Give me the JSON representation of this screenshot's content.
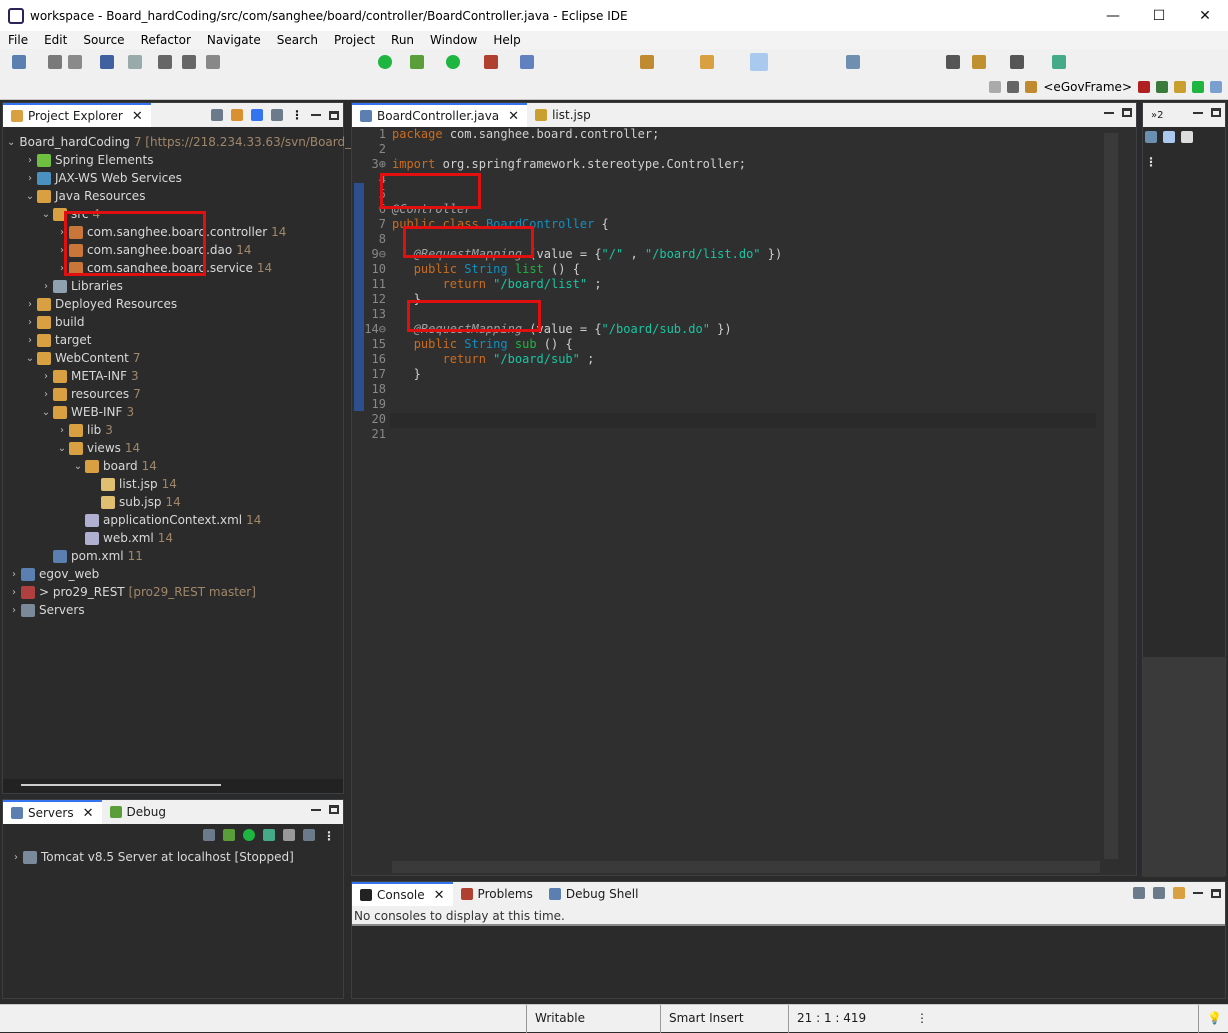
{
  "window": {
    "title": "workspace - Board_hardCoding/src/com/sanghee/board/controller/BoardController.java - Eclipse IDE",
    "min": "—",
    "max": "☐",
    "close": "✕"
  },
  "menu": [
    "File",
    "Edit",
    "Source",
    "Refactor",
    "Navigate",
    "Search",
    "Project",
    "Run",
    "Window",
    "Help"
  ],
  "perspective": {
    "label": "<eGovFrame>"
  },
  "explorer": {
    "tab": "Project Explorer",
    "items": [
      {
        "label": "Board_hardCoding",
        "dec": "7 [https://218.234.33.63/svn/Board_",
        "indent": 0,
        "arrow": "v"
      },
      {
        "label": "Spring Elements",
        "dec": "",
        "indent": 1,
        "arrow": ">"
      },
      {
        "label": "JAX-WS Web Services",
        "dec": "",
        "indent": 1,
        "arrow": ">"
      },
      {
        "label": "Java Resources",
        "dec": "",
        "indent": 1,
        "arrow": "v"
      },
      {
        "label": "src",
        "dec": "4",
        "indent": 2,
        "arrow": "v"
      },
      {
        "label": "com.sanghee.board.controller",
        "dec": "14",
        "indent": 3,
        "arrow": ">"
      },
      {
        "label": "com.sanghee.board.dao",
        "dec": "14",
        "indent": 3,
        "arrow": ">"
      },
      {
        "label": "com.sanghee.board.service",
        "dec": "14",
        "indent": 3,
        "arrow": ">"
      },
      {
        "label": "Libraries",
        "dec": "",
        "indent": 2,
        "arrow": ">"
      },
      {
        "label": "Deployed Resources",
        "dec": "",
        "indent": 1,
        "arrow": ">"
      },
      {
        "label": "build",
        "dec": "",
        "indent": 1,
        "arrow": ">"
      },
      {
        "label": "target",
        "dec": "",
        "indent": 1,
        "arrow": ">"
      },
      {
        "label": "WebContent",
        "dec": "7",
        "indent": 1,
        "arrow": "v"
      },
      {
        "label": "META-INF",
        "dec": "3",
        "indent": 2,
        "arrow": ">"
      },
      {
        "label": "resources",
        "dec": "7",
        "indent": 2,
        "arrow": ">"
      },
      {
        "label": "WEB-INF",
        "dec": "3",
        "indent": 2,
        "arrow": "v"
      },
      {
        "label": "lib",
        "dec": "3",
        "indent": 3,
        "arrow": ">"
      },
      {
        "label": "views",
        "dec": "14",
        "indent": 3,
        "arrow": "v"
      },
      {
        "label": "board",
        "dec": "14",
        "indent": 4,
        "arrow": "v"
      },
      {
        "label": "list.jsp",
        "dec": "14",
        "indent": 5,
        "arrow": ""
      },
      {
        "label": "sub.jsp",
        "dec": "14",
        "indent": 5,
        "arrow": ""
      },
      {
        "label": "applicationContext.xml",
        "dec": "14",
        "indent": 4,
        "arrow": ""
      },
      {
        "label": "web.xml",
        "dec": "14",
        "indent": 4,
        "arrow": ""
      },
      {
        "label": "pom.xml",
        "dec": "11",
        "indent": 2,
        "arrow": ""
      },
      {
        "label": "egov_web",
        "dec": "",
        "indent": 0,
        "arrow": ">"
      },
      {
        "label": "> pro29_REST",
        "dec": "[pro29_REST master]",
        "indent": 0,
        "arrow": ">"
      },
      {
        "label": "Servers",
        "dec": "",
        "indent": 0,
        "arrow": ">"
      }
    ]
  },
  "servers": {
    "tab1": "Servers",
    "tab2": "Debug",
    "item": "Tomcat v8.5 Server at localhost  [Stopped]"
  },
  "editor": {
    "tab1": "BoardController.java",
    "tab2": "list.jsp",
    "lines": [
      {
        "n": "1",
        "parts": [
          [
            "kw",
            "package"
          ],
          [
            "",
            "com.sanghee.board.controller;"
          ]
        ]
      },
      {
        "n": "2",
        "parts": []
      },
      {
        "n": "3⊕",
        "parts": [
          [
            "kw",
            "import"
          ],
          [
            "",
            "org.springframework.stereotype.Controller;"
          ]
        ]
      },
      {
        "n": "4",
        "parts": []
      },
      {
        "n": "5",
        "parts": []
      },
      {
        "n": "6",
        "parts": [
          [
            "ann",
            "@Controller"
          ]
        ]
      },
      {
        "n": "7",
        "parts": [
          [
            "kw",
            "public class"
          ],
          [
            "cls",
            "BoardController"
          ],
          [
            "",
            "{"
          ]
        ]
      },
      {
        "n": "8",
        "parts": []
      },
      {
        "n": "9⊖",
        "parts": [
          [
            "",
            "   "
          ],
          [
            "ann",
            "@RequestMapping"
          ],
          [
            "",
            "(value = {"
          ],
          [
            "str",
            "\"/\""
          ],
          [
            "",
            ", "
          ],
          [
            "str",
            "\"/board/list.do\""
          ],
          [
            "",
            "})"
          ]
        ]
      },
      {
        "n": "10",
        "parts": [
          [
            "",
            "   "
          ],
          [
            "kw",
            "public"
          ],
          [
            "cls",
            "String"
          ],
          [
            "fn",
            "list"
          ],
          [
            "",
            "() {"
          ]
        ]
      },
      {
        "n": "11",
        "parts": [
          [
            "",
            "       "
          ],
          [
            "kw",
            "return"
          ],
          [
            "str",
            "\"/board/list\""
          ],
          [
            "",
            ";"
          ]
        ]
      },
      {
        "n": "12",
        "parts": [
          [
            "",
            "   }"
          ]
        ]
      },
      {
        "n": "13",
        "parts": []
      },
      {
        "n": "14⊖",
        "parts": [
          [
            "",
            "   "
          ],
          [
            "ann",
            "@RequestMapping"
          ],
          [
            "",
            "(value = {"
          ],
          [
            "str",
            "\"/board/sub.do\""
          ],
          [
            "",
            "})"
          ]
        ]
      },
      {
        "n": "15",
        "parts": [
          [
            "",
            "   "
          ],
          [
            "kw",
            "public"
          ],
          [
            "cls",
            "String"
          ],
          [
            "fn",
            "sub"
          ],
          [
            "",
            "() {"
          ]
        ]
      },
      {
        "n": "16",
        "parts": [
          [
            "",
            "       "
          ],
          [
            "kw",
            "return"
          ],
          [
            "str",
            "\"/board/sub\""
          ],
          [
            "",
            ";"
          ]
        ]
      },
      {
        "n": "17",
        "parts": [
          [
            "",
            "   }"
          ]
        ]
      },
      {
        "n": "18",
        "parts": []
      },
      {
        "n": "19",
        "parts": []
      },
      {
        "n": "20",
        "parts": [
          [
            "",
            "}"
          ]
        ]
      },
      {
        "n": "21",
        "parts": []
      }
    ]
  },
  "console": {
    "tab1": "Console",
    "tab2": "Problems",
    "tab3": "Debug Shell",
    "message": "No consoles to display at this time."
  },
  "status": {
    "writable": "Writable",
    "insert": "Smart Insert",
    "pos": "21 : 1 : 419"
  },
  "colors": {
    "accent": "#3574f0",
    "highlight": "#e01010"
  }
}
